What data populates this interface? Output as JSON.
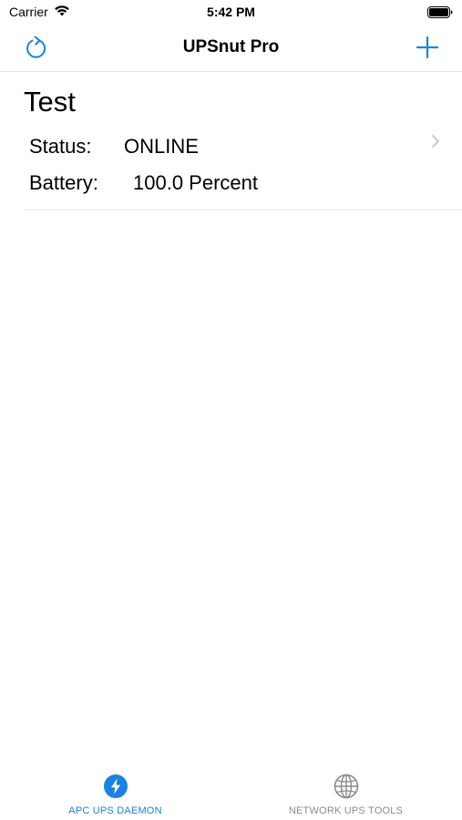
{
  "status_bar": {
    "carrier": "Carrier",
    "time": "5:42 PM"
  },
  "nav": {
    "title": "UPSnut Pro",
    "refresh_icon": "refresh-icon",
    "add_icon": "plus-icon"
  },
  "ups_list": [
    {
      "name": "Test",
      "status_label": "Status:",
      "status_value": "ONLINE",
      "battery_label": "Battery:",
      "battery_value": "100.0 Percent"
    }
  ],
  "tabs": [
    {
      "label": "APC UPS DAEMON",
      "icon": "bolt-icon",
      "selected": true
    },
    {
      "label": "NETWORK UPS TOOLS",
      "icon": "globe-icon",
      "selected": false
    }
  ],
  "colors": {
    "accent": "#1a82e2",
    "inactive": "#8a8a8e",
    "separator": "#e4e4e6"
  }
}
